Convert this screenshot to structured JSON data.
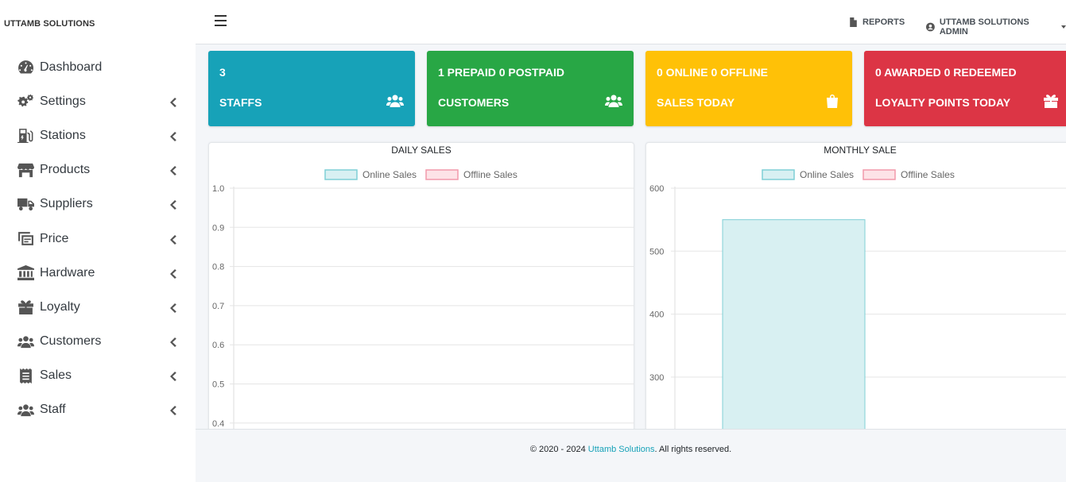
{
  "brand": "UTTAMB SOLUTIONS",
  "sidebar": {
    "items": [
      {
        "label": "Dashboard",
        "icon": "tachometer-icon",
        "submenu": false
      },
      {
        "label": "Settings",
        "icon": "cogs-icon",
        "submenu": true
      },
      {
        "label": "Stations",
        "icon": "gas-pump-icon",
        "submenu": true
      },
      {
        "label": "Products",
        "icon": "store-icon",
        "submenu": true
      },
      {
        "label": "Suppliers",
        "icon": "truck-icon",
        "submenu": true
      },
      {
        "label": "Price",
        "icon": "price-tag-icon",
        "submenu": true
      },
      {
        "label": "Hardware",
        "icon": "landmark-icon",
        "submenu": true
      },
      {
        "label": "Loyalty",
        "icon": "gift-icon",
        "submenu": true
      },
      {
        "label": "Customers",
        "icon": "users-icon",
        "submenu": true
      },
      {
        "label": "Sales",
        "icon": "receipt-icon",
        "submenu": true
      },
      {
        "label": "Staff",
        "icon": "users-icon",
        "submenu": true
      }
    ]
  },
  "topbar": {
    "reports_label": "REPORTS",
    "user_label": "UTTAMB SOLUTIONS ADMIN"
  },
  "cards": [
    {
      "line1": "3",
      "line2": "STAFFS",
      "icon": "users-icon",
      "color": "#17a2b8"
    },
    {
      "line1": "1 PREPAID 0 POSTPAID",
      "line2": "CUSTOMERS",
      "icon": "users-icon",
      "color": "#28a745"
    },
    {
      "line1": "0 ONLINE 0 OFFLINE",
      "line2": "SALES TODAY",
      "icon": "shopping-bag-icon",
      "color": "#ffc107"
    },
    {
      "line1": "0 AWARDED 0 REDEEMED",
      "line2": "LOYALTY POINTS TODAY",
      "icon": "gift-icon",
      "color": "#dc3545"
    }
  ],
  "chart_data": [
    {
      "type": "bar",
      "title": "DAILY SALES",
      "legend": [
        "Online Sales",
        "Offline Sales"
      ],
      "legend_position": "top",
      "colors": {
        "online_fill": "#d8f0f2",
        "online_border": "#7fcfd6",
        "offline_fill": "#fde3e7",
        "offline_border": "#f29aab"
      },
      "y_ticks": [
        "1.0",
        "0.9",
        "0.8",
        "0.7",
        "0.6",
        "0.5",
        "0.4"
      ],
      "ylim": [
        0,
        1.0
      ],
      "series": [
        {
          "name": "Online Sales",
          "values": []
        },
        {
          "name": "Offline Sales",
          "values": []
        }
      ],
      "grid": true
    },
    {
      "type": "bar",
      "title": "MONTHLY SALE",
      "legend": [
        "Online Sales",
        "Offline Sales"
      ],
      "legend_position": "top",
      "colors": {
        "online_fill": "#d8f0f2",
        "online_border": "#7fcfd6",
        "offline_fill": "#fde3e7",
        "offline_border": "#f29aab"
      },
      "y_ticks": [
        "600",
        "500",
        "400",
        "300"
      ],
      "ylim": [
        0,
        600
      ],
      "series": [
        {
          "name": "Online Sales",
          "values": [
            550
          ]
        },
        {
          "name": "Offline Sales",
          "values": [
            0
          ]
        }
      ],
      "grid": true
    }
  ],
  "footer": {
    "prefix": "© 2020 - 2024 ",
    "link": "Uttamb Solutions",
    "suffix": ". All rights reserved."
  }
}
